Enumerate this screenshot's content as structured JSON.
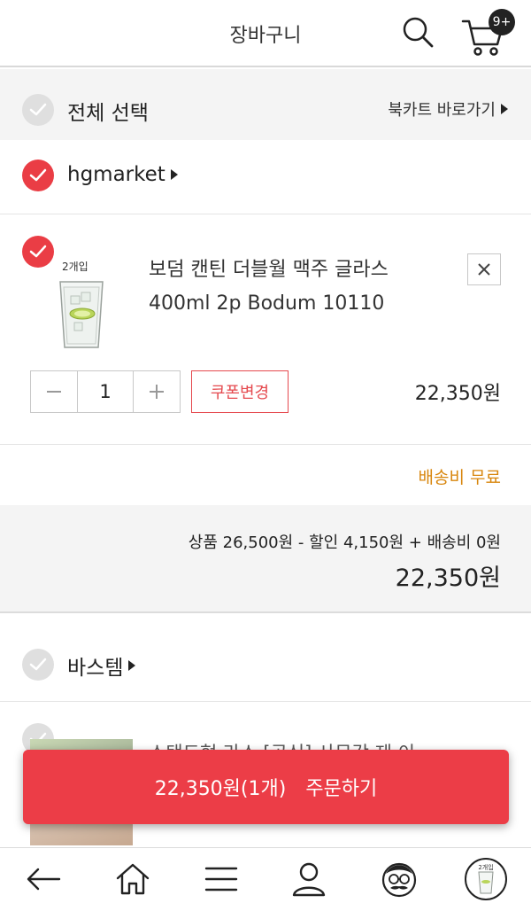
{
  "header": {
    "title": "장바구니",
    "cart_badge": "9+"
  },
  "select_all": {
    "label": "전체 선택",
    "shortcut": "북카트 바로가기"
  },
  "seller1": {
    "name": "hgmarket",
    "item": {
      "thumb_caption": "2개입",
      "name": "보덤 캔틴 더블월 맥주 글라스400ml 2p Bodum 10110",
      "quantity": "1",
      "coupon_label": "쿠폰변경",
      "price": "22,350원"
    },
    "shipping": "배송비 무료",
    "summary": {
      "breakdown": "상품 26,500원 - 할인 4,150원 + 배송비 0원",
      "total": "22,350원"
    }
  },
  "seller2": {
    "name": "바스템",
    "item_name_partial": "스탠드형 라스 [공식] 사무각 제 이"
  },
  "order_button": {
    "amount": "22,350원(1개)",
    "action": "주문하기"
  },
  "bottom_nav": {
    "recent_caption": "2개입"
  },
  "colors": {
    "accent": "#ec3d47",
    "shipping": "#d8860d"
  }
}
